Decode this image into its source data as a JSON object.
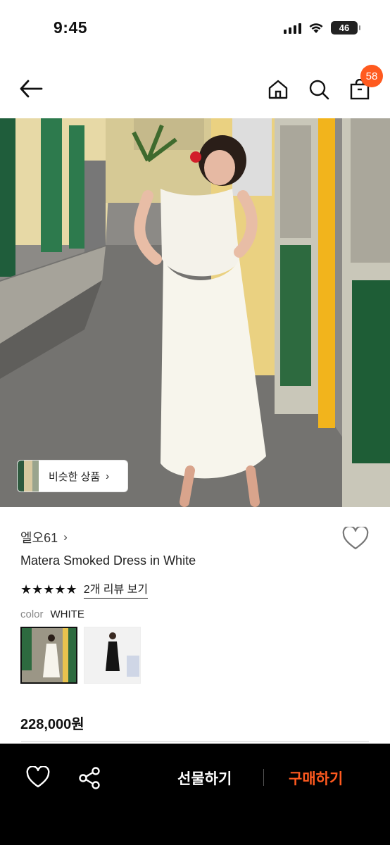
{
  "status_bar": {
    "time": "9:45",
    "battery": "46"
  },
  "header": {
    "cart_count": "58"
  },
  "hero": {
    "similar_label": "비슷한 상품",
    "similar_chevron": "›"
  },
  "product": {
    "brand": "엘오61",
    "brand_chevron": "›",
    "title": "Matera Smoked Dress in White",
    "stars": "★★★★★",
    "rating_out_of_5": 5,
    "review_link": "2개 리뷰 보기",
    "color_label": "color",
    "color_value": "WHITE",
    "price": "228,000원"
  },
  "bottom_bar": {
    "gift_label": "선물하기",
    "buy_label": "구매하기"
  },
  "colors": {
    "accent": "#ff5a1f",
    "bar_bg": "#000000"
  }
}
